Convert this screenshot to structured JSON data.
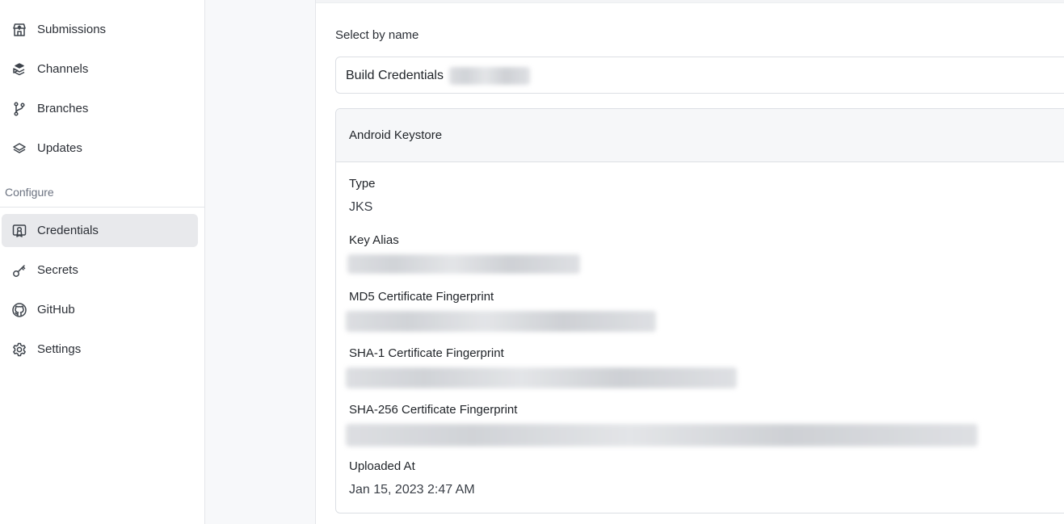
{
  "sidebar": {
    "items_top": [
      {
        "label": "Submissions",
        "icon": "submissions-icon"
      },
      {
        "label": "Channels",
        "icon": "channels-icon"
      },
      {
        "label": "Branches",
        "icon": "branches-icon"
      },
      {
        "label": "Updates",
        "icon": "updates-icon"
      }
    ],
    "section_label": "Configure",
    "items_configure": [
      {
        "label": "Credentials",
        "icon": "credentials-icon",
        "active": true
      },
      {
        "label": "Secrets",
        "icon": "key-icon"
      },
      {
        "label": "GitHub",
        "icon": "github-icon"
      },
      {
        "label": "Settings",
        "icon": "gear-icon"
      }
    ]
  },
  "main": {
    "select_label": "Select by name",
    "select_value": "Build Credentials",
    "card": {
      "title": "Android Keystore",
      "fields": [
        {
          "label": "Type",
          "value": "JKS"
        },
        {
          "label": "Key Alias",
          "value": ""
        },
        {
          "label": "MD5 Certificate Fingerprint",
          "value": ""
        },
        {
          "label": "SHA-1 Certificate Fingerprint",
          "value": ""
        },
        {
          "label": "SHA-256 Certificate Fingerprint",
          "value": ""
        },
        {
          "label": "Uploaded At",
          "value": "Jan 15, 2023 2:47 AM"
        }
      ]
    }
  },
  "colors": {
    "active_bg": "#e8e9ec",
    "border": "#dcdfe4",
    "card_header_bg": "#f6f7f9",
    "icon_stroke": "#3d434b"
  }
}
